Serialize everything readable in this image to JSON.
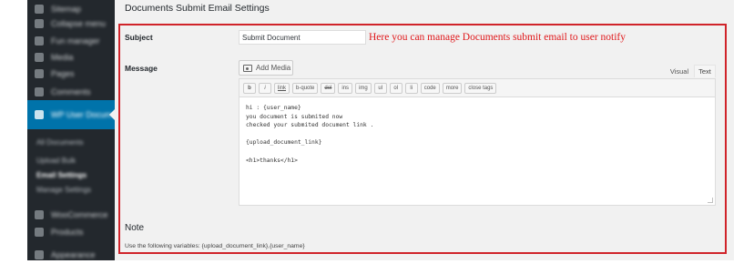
{
  "page": {
    "title": "Documents Submit Email Settings"
  },
  "sidebar": {
    "items": [
      {
        "label": "Sitemap",
        "icon": "gauge-icon"
      },
      {
        "label": "Collapse menu",
        "icon": "collapse-icon"
      },
      {
        "label": "Fun manager",
        "icon": "puzzle-icon"
      },
      {
        "label": "Media",
        "icon": "media-icon"
      },
      {
        "label": "Pages",
        "icon": "page-icon"
      },
      {
        "label": "Comments",
        "icon": "comment-icon"
      },
      {
        "label": "WP User Documents",
        "icon": "pin-icon"
      }
    ],
    "submenu": [
      {
        "label": "All Documents"
      },
      {
        "label": "Upload Bulk"
      },
      {
        "label": "Email Settings"
      },
      {
        "label": "Manage Settings"
      }
    ],
    "bottom_items": [
      {
        "label": "WooCommerce",
        "icon": "woo-icon"
      },
      {
        "label": "Products",
        "icon": "box-icon"
      },
      {
        "label": "Appearance",
        "icon": "brush-icon"
      }
    ]
  },
  "form": {
    "subject_label": "Subject",
    "subject_value": "Submit Document",
    "message_label": "Message",
    "add_media_label": "Add Media",
    "tab_visual": "Visual",
    "tab_text": "Text",
    "toolbar": [
      "b",
      "i",
      "link",
      "b-quote",
      "del",
      "ins",
      "img",
      "ul",
      "ol",
      "li",
      "code",
      "more",
      "close tags"
    ],
    "message_body": "hi : {user_name}\nyou document is submited now\nchecked your submited document link .\n\n{upload_document_link}\n\n<h1>thanks</h1>"
  },
  "annotation": {
    "text": "Here you can manage Documents submit email to user notify",
    "color": "#e0181b"
  },
  "note": {
    "title": "Note",
    "text": "Use the following variables: {upload_document_link},{user_name}"
  },
  "colors": {
    "sidebar_bg": "#23282d",
    "sidebar_active": "#0073aa",
    "content_bg": "#f1f1f1",
    "highlight_border": "#d0232a"
  }
}
